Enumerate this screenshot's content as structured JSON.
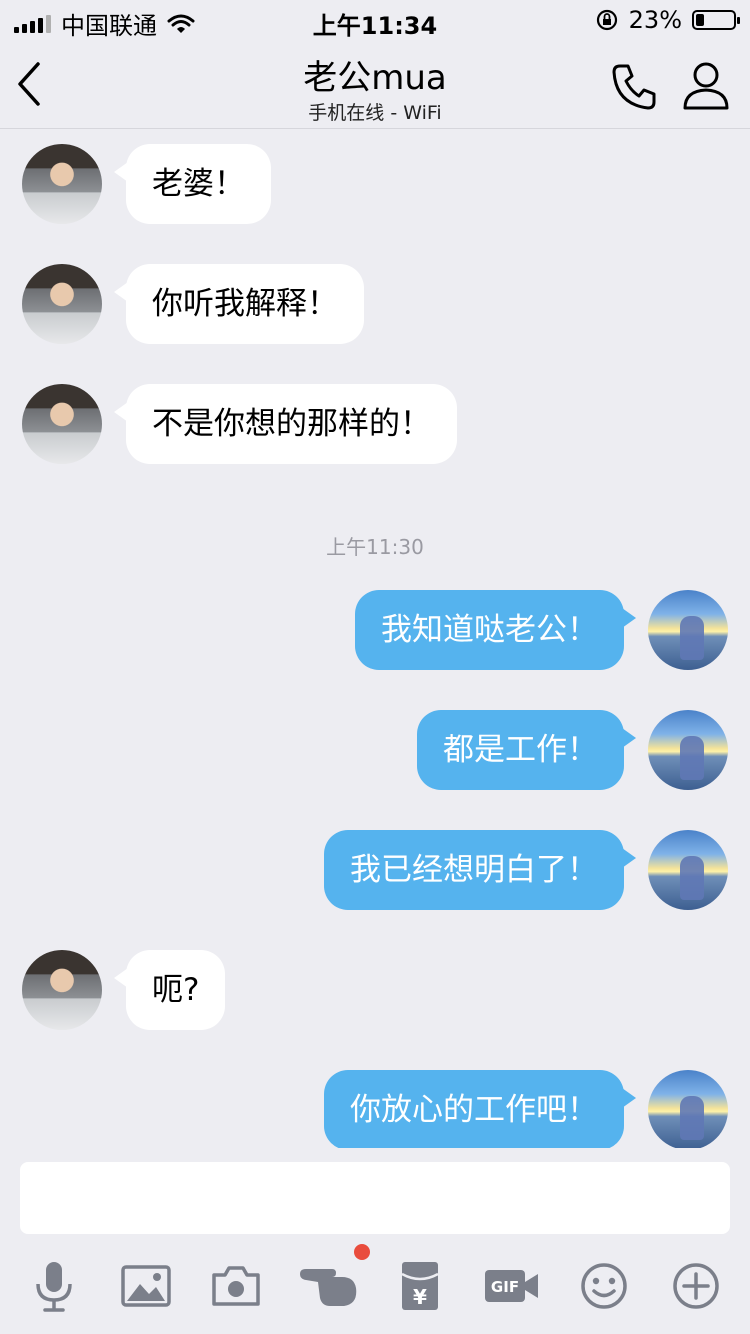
{
  "status_bar": {
    "carrier": "中国联通",
    "time": "上午11:34",
    "battery_percent_label": "23%",
    "battery_level": 0.23
  },
  "header": {
    "title": "老公mua",
    "subtitle": "手机在线 - WiFi"
  },
  "chat": {
    "timestamp": "上午11:30",
    "messages": [
      {
        "side": "left",
        "text": "老婆！"
      },
      {
        "side": "left",
        "text": "你听我解释！"
      },
      {
        "side": "left",
        "text": "不是你想的那样的！"
      },
      {
        "side": "right",
        "text": "我知道哒老公！"
      },
      {
        "side": "right",
        "text": "都是工作！"
      },
      {
        "side": "right",
        "text": "我已经想明白了！"
      },
      {
        "side": "left",
        "text": "呃?"
      },
      {
        "side": "right",
        "text": "你放心的工作吧！"
      }
    ]
  },
  "input": {
    "value": ""
  },
  "toolbar": {
    "icons": [
      "microphone-icon",
      "image-icon",
      "camera-icon",
      "poke-hand-icon",
      "red-packet-icon",
      "gif-icon",
      "emoji-icon",
      "plus-icon"
    ]
  },
  "colors": {
    "background": "#ededf2",
    "sent_bubble": "#55b3ee",
    "received_bubble": "#ffffff",
    "notification_dot": "#e94c3d",
    "icon_gray": "#7b7f8a"
  }
}
